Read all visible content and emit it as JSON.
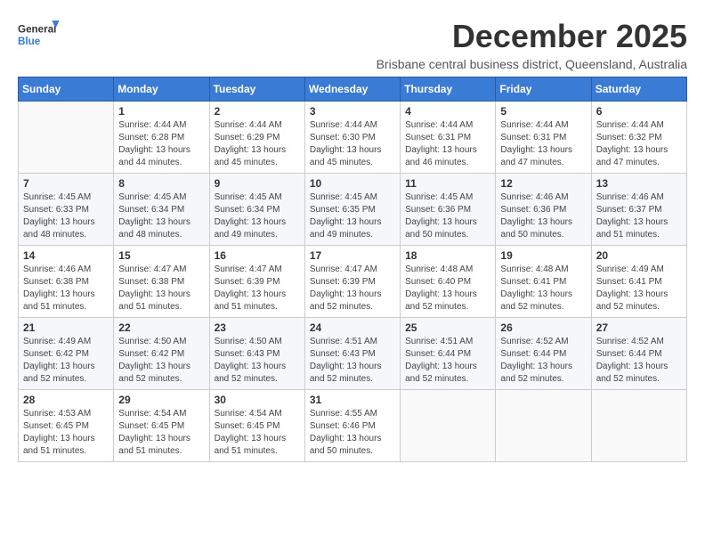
{
  "logo": {
    "text_general": "General",
    "text_blue": "Blue"
  },
  "header": {
    "month_title": "December 2025",
    "subtitle": "Brisbane central business district, Queensland, Australia"
  },
  "weekdays": [
    "Sunday",
    "Monday",
    "Tuesday",
    "Wednesday",
    "Thursday",
    "Friday",
    "Saturday"
  ],
  "weeks": [
    [
      {
        "day": "",
        "info": ""
      },
      {
        "day": "1",
        "info": "Sunrise: 4:44 AM\nSunset: 6:28 PM\nDaylight: 13 hours\nand 44 minutes."
      },
      {
        "day": "2",
        "info": "Sunrise: 4:44 AM\nSunset: 6:29 PM\nDaylight: 13 hours\nand 45 minutes."
      },
      {
        "day": "3",
        "info": "Sunrise: 4:44 AM\nSunset: 6:30 PM\nDaylight: 13 hours\nand 45 minutes."
      },
      {
        "day": "4",
        "info": "Sunrise: 4:44 AM\nSunset: 6:31 PM\nDaylight: 13 hours\nand 46 minutes."
      },
      {
        "day": "5",
        "info": "Sunrise: 4:44 AM\nSunset: 6:31 PM\nDaylight: 13 hours\nand 47 minutes."
      },
      {
        "day": "6",
        "info": "Sunrise: 4:44 AM\nSunset: 6:32 PM\nDaylight: 13 hours\nand 47 minutes."
      }
    ],
    [
      {
        "day": "7",
        "info": "Sunrise: 4:45 AM\nSunset: 6:33 PM\nDaylight: 13 hours\nand 48 minutes."
      },
      {
        "day": "8",
        "info": "Sunrise: 4:45 AM\nSunset: 6:34 PM\nDaylight: 13 hours\nand 48 minutes."
      },
      {
        "day": "9",
        "info": "Sunrise: 4:45 AM\nSunset: 6:34 PM\nDaylight: 13 hours\nand 49 minutes."
      },
      {
        "day": "10",
        "info": "Sunrise: 4:45 AM\nSunset: 6:35 PM\nDaylight: 13 hours\nand 49 minutes."
      },
      {
        "day": "11",
        "info": "Sunrise: 4:45 AM\nSunset: 6:36 PM\nDaylight: 13 hours\nand 50 minutes."
      },
      {
        "day": "12",
        "info": "Sunrise: 4:46 AM\nSunset: 6:36 PM\nDaylight: 13 hours\nand 50 minutes."
      },
      {
        "day": "13",
        "info": "Sunrise: 4:46 AM\nSunset: 6:37 PM\nDaylight: 13 hours\nand 51 minutes."
      }
    ],
    [
      {
        "day": "14",
        "info": "Sunrise: 4:46 AM\nSunset: 6:38 PM\nDaylight: 13 hours\nand 51 minutes."
      },
      {
        "day": "15",
        "info": "Sunrise: 4:47 AM\nSunset: 6:38 PM\nDaylight: 13 hours\nand 51 minutes."
      },
      {
        "day": "16",
        "info": "Sunrise: 4:47 AM\nSunset: 6:39 PM\nDaylight: 13 hours\nand 51 minutes."
      },
      {
        "day": "17",
        "info": "Sunrise: 4:47 AM\nSunset: 6:39 PM\nDaylight: 13 hours\nand 52 minutes."
      },
      {
        "day": "18",
        "info": "Sunrise: 4:48 AM\nSunset: 6:40 PM\nDaylight: 13 hours\nand 52 minutes."
      },
      {
        "day": "19",
        "info": "Sunrise: 4:48 AM\nSunset: 6:41 PM\nDaylight: 13 hours\nand 52 minutes."
      },
      {
        "day": "20",
        "info": "Sunrise: 4:49 AM\nSunset: 6:41 PM\nDaylight: 13 hours\nand 52 minutes."
      }
    ],
    [
      {
        "day": "21",
        "info": "Sunrise: 4:49 AM\nSunset: 6:42 PM\nDaylight: 13 hours\nand 52 minutes."
      },
      {
        "day": "22",
        "info": "Sunrise: 4:50 AM\nSunset: 6:42 PM\nDaylight: 13 hours\nand 52 minutes."
      },
      {
        "day": "23",
        "info": "Sunrise: 4:50 AM\nSunset: 6:43 PM\nDaylight: 13 hours\nand 52 minutes."
      },
      {
        "day": "24",
        "info": "Sunrise: 4:51 AM\nSunset: 6:43 PM\nDaylight: 13 hours\nand 52 minutes."
      },
      {
        "day": "25",
        "info": "Sunrise: 4:51 AM\nSunset: 6:44 PM\nDaylight: 13 hours\nand 52 minutes."
      },
      {
        "day": "26",
        "info": "Sunrise: 4:52 AM\nSunset: 6:44 PM\nDaylight: 13 hours\nand 52 minutes."
      },
      {
        "day": "27",
        "info": "Sunrise: 4:52 AM\nSunset: 6:44 PM\nDaylight: 13 hours\nand 52 minutes."
      }
    ],
    [
      {
        "day": "28",
        "info": "Sunrise: 4:53 AM\nSunset: 6:45 PM\nDaylight: 13 hours\nand 51 minutes."
      },
      {
        "day": "29",
        "info": "Sunrise: 4:54 AM\nSunset: 6:45 PM\nDaylight: 13 hours\nand 51 minutes."
      },
      {
        "day": "30",
        "info": "Sunrise: 4:54 AM\nSunset: 6:45 PM\nDaylight: 13 hours\nand 51 minutes."
      },
      {
        "day": "31",
        "info": "Sunrise: 4:55 AM\nSunset: 6:46 PM\nDaylight: 13 hours\nand 50 minutes."
      },
      {
        "day": "",
        "info": ""
      },
      {
        "day": "",
        "info": ""
      },
      {
        "day": "",
        "info": ""
      }
    ]
  ]
}
